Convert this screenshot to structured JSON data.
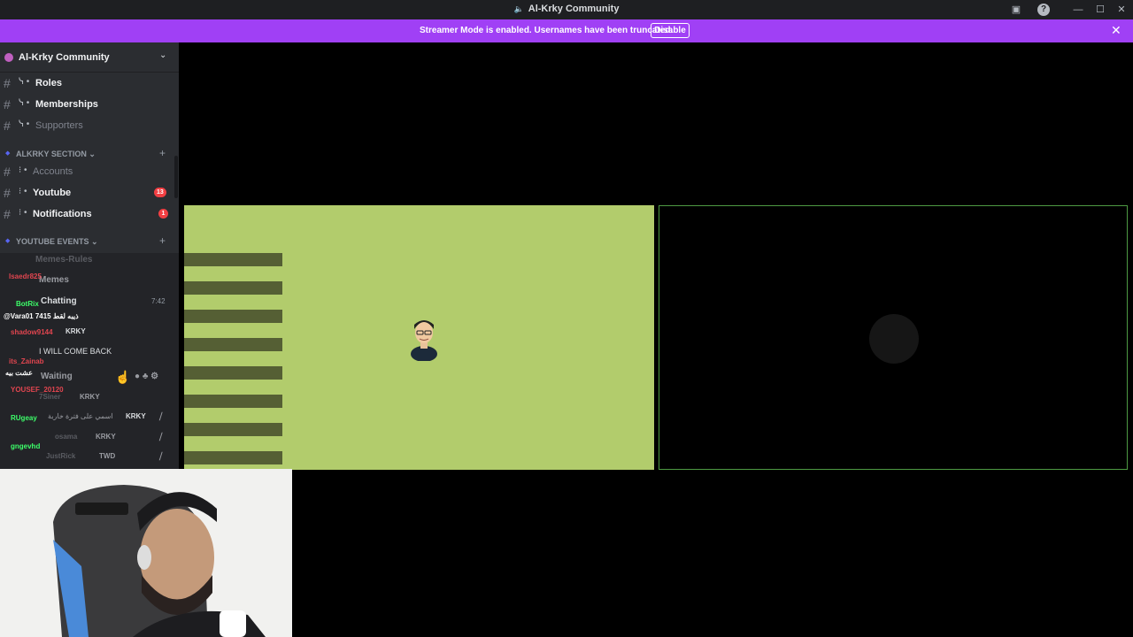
{
  "window": {
    "title": "Al-Krky Community",
    "controls": {
      "minimize": "—",
      "maximize": "☐",
      "close": "✕"
    }
  },
  "banner": {
    "text": "Streamer Mode is enabled. Usernames have been truncated.",
    "button": "Disable",
    "close": "✕"
  },
  "server": {
    "name": "Al-Krky Community"
  },
  "channels_top": [
    {
      "prefix": "ᓭ •",
      "name": "Roles",
      "muted": false
    },
    {
      "prefix": "ᓭ •",
      "name": "Memberships",
      "muted": false
    },
    {
      "prefix": "ᓭ •",
      "name": "Supporters",
      "muted": true
    }
  ],
  "categories": [
    {
      "name": "ALKRKY SECTION ⌄",
      "plus": "+"
    },
    {
      "name": "YOUTUBE EVENTS ⌄",
      "plus": "+"
    }
  ],
  "section_channels": [
    {
      "prefix": "⁝ •",
      "name": "Accounts",
      "muted": true,
      "badge": ""
    },
    {
      "prefix": "⁝ •",
      "name": "Youtube",
      "muted": false,
      "badge": "13"
    },
    {
      "prefix": "⁝ •",
      "name": "Notifications",
      "muted": false,
      "badge": "1"
    }
  ],
  "overlay": {
    "channels": [
      "Memes-Rules",
      "Memes",
      "Chatting",
      "Waiting"
    ],
    "chat": [
      {
        "user": "Isaedr825",
        "color": "#e0454f"
      },
      {
        "user": "BotRix",
        "color": "#3dff6a"
      },
      {
        "user": "@Vara01 7415 ذيبه لقط",
        "color": "#ffffff"
      },
      {
        "user": "shadow9144",
        "color": "#e0454f"
      },
      {
        "user": "its_Zainab",
        "color": "#e0454f"
      },
      {
        "user": "عشت بيه",
        "color": "#ffffff"
      },
      {
        "user": "YOUSEF_20120",
        "color": "#e0454f"
      },
      {
        "user": "RUgeay",
        "color": "#3dff6a"
      },
      {
        "user": "gngevhd",
        "color": "#3dff6a"
      }
    ],
    "time": "7:42",
    "voice_users": [
      {
        "name": "KRKY",
        "tag": ""
      },
      {
        "name": "I WILL COME BACK",
        "tag": ""
      },
      {
        "name": "7Siner",
        "tag": "KRKY"
      },
      {
        "name": "اسمي على فترة خاربة",
        "tag": "KRKY"
      },
      {
        "name": "osama",
        "tag": "KRKY"
      },
      {
        "name": "JustRick",
        "tag": "TWD"
      }
    ]
  }
}
